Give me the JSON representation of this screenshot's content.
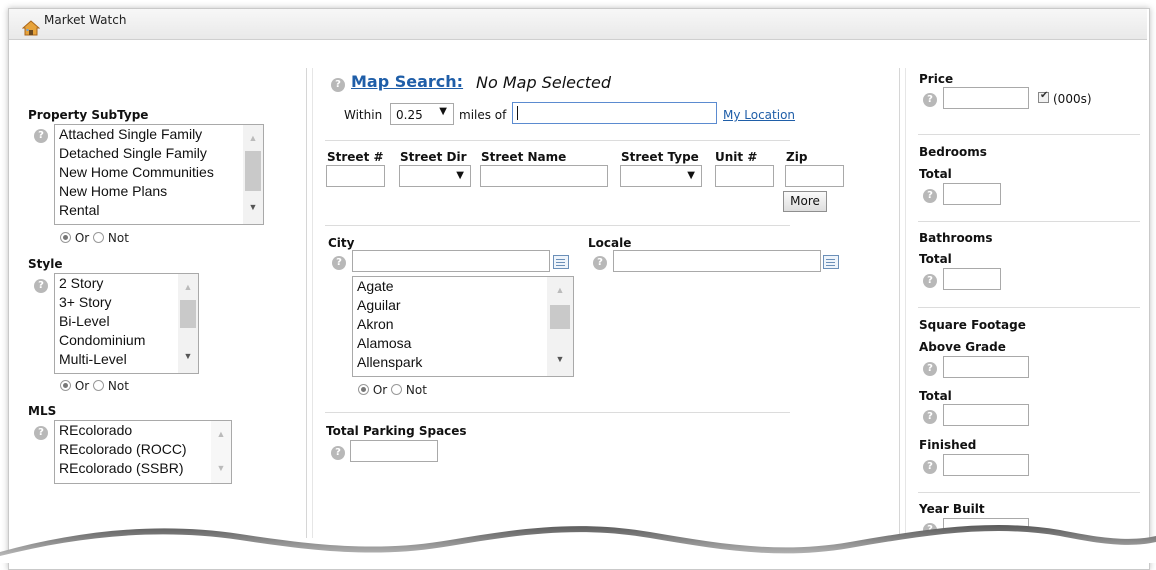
{
  "window": {
    "title": "Market Watch",
    "home_icon": "house-icon"
  },
  "property_subtype": {
    "label": "Property SubType",
    "options": [
      "Attached Single Family",
      "Detached Single Family",
      "New Home Communities",
      "New Home Plans",
      "Rental"
    ],
    "or_label": "Or",
    "not_label": "Not",
    "mode": "Or"
  },
  "style": {
    "label": "Style",
    "options": [
      "2 Story",
      "3+ Story",
      "Bi-Level",
      "Condominium",
      "Multi-Level"
    ],
    "or_label": "Or",
    "not_label": "Not",
    "mode": "Or"
  },
  "mls": {
    "label": "MLS",
    "options": [
      "REcolorado",
      "REcolorado (ROCC)",
      "REcolorado (SSBR)"
    ]
  },
  "map_search": {
    "link": "Map Search:",
    "status": "No Map Selected",
    "within_label": "Within",
    "distance": "0.25",
    "miles_of_label": "miles of",
    "location_value": "",
    "my_location": "My Location"
  },
  "address": {
    "street_num": "Street #",
    "street_dir": "Street Dir",
    "street_name": "Street Name",
    "street_type": "Street Type",
    "unit": "Unit #",
    "zip": "Zip",
    "more_button": "More"
  },
  "city": {
    "label": "City",
    "options": [
      "Agate",
      "Aguilar",
      "Akron",
      "Alamosa",
      "Allenspark"
    ],
    "or_label": "Or",
    "not_label": "Not",
    "mode": "Or"
  },
  "locale": {
    "label": "Locale"
  },
  "parking": {
    "label": "Total Parking Spaces"
  },
  "price": {
    "label": "Price",
    "thousands_label": "(000s)",
    "thousands_checked": true
  },
  "bedrooms": {
    "label": "Bedrooms",
    "total_label": "Total"
  },
  "bathrooms": {
    "label": "Bathrooms",
    "total_label": "Total"
  },
  "square_footage": {
    "label": "Square Footage",
    "above_grade_label": "Above Grade",
    "total_label": "Total",
    "finished_label": "Finished"
  },
  "year_built": {
    "label": "Year Built"
  },
  "colors": {
    "link": "#1f5ea8",
    "help_icon": "#b8b8b8",
    "border": "#a9a9a9"
  }
}
